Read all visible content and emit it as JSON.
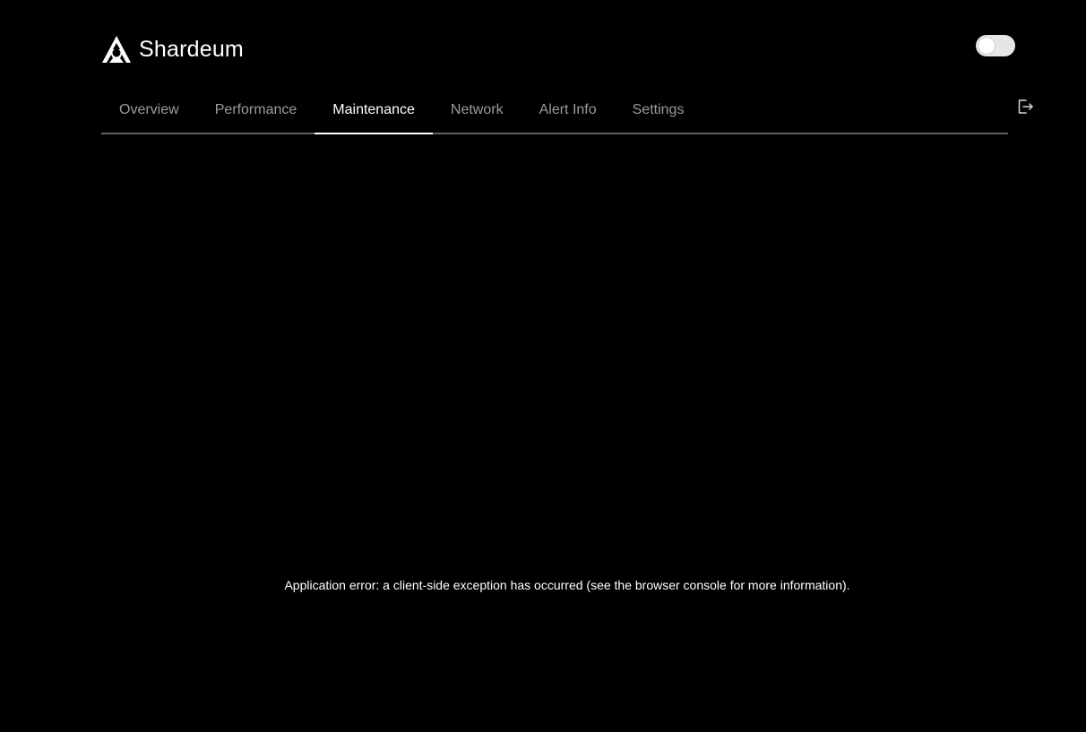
{
  "brand": {
    "name": "Shardeum",
    "logo_icon": "shardeum-logo-icon"
  },
  "header": {
    "theme_toggle": {
      "state": "off",
      "icon": "toggle-switch"
    },
    "logout": {
      "icon": "logout-icon"
    }
  },
  "tabs": [
    {
      "label": "Overview",
      "active": false
    },
    {
      "label": "Performance",
      "active": false
    },
    {
      "label": "Maintenance",
      "active": true
    },
    {
      "label": "Network",
      "active": false
    },
    {
      "label": "Alert Info",
      "active": false
    },
    {
      "label": "Settings",
      "active": false
    }
  ],
  "error": {
    "message": "Application error: a client-side exception has occurred (see the browser console for more information)."
  },
  "colors": {
    "background": "#000000",
    "text": "#ffffff",
    "tab_inactive": "#9a9aa2",
    "tab_border": "#5f5f66",
    "toggle_track": "#e6e6e6"
  }
}
